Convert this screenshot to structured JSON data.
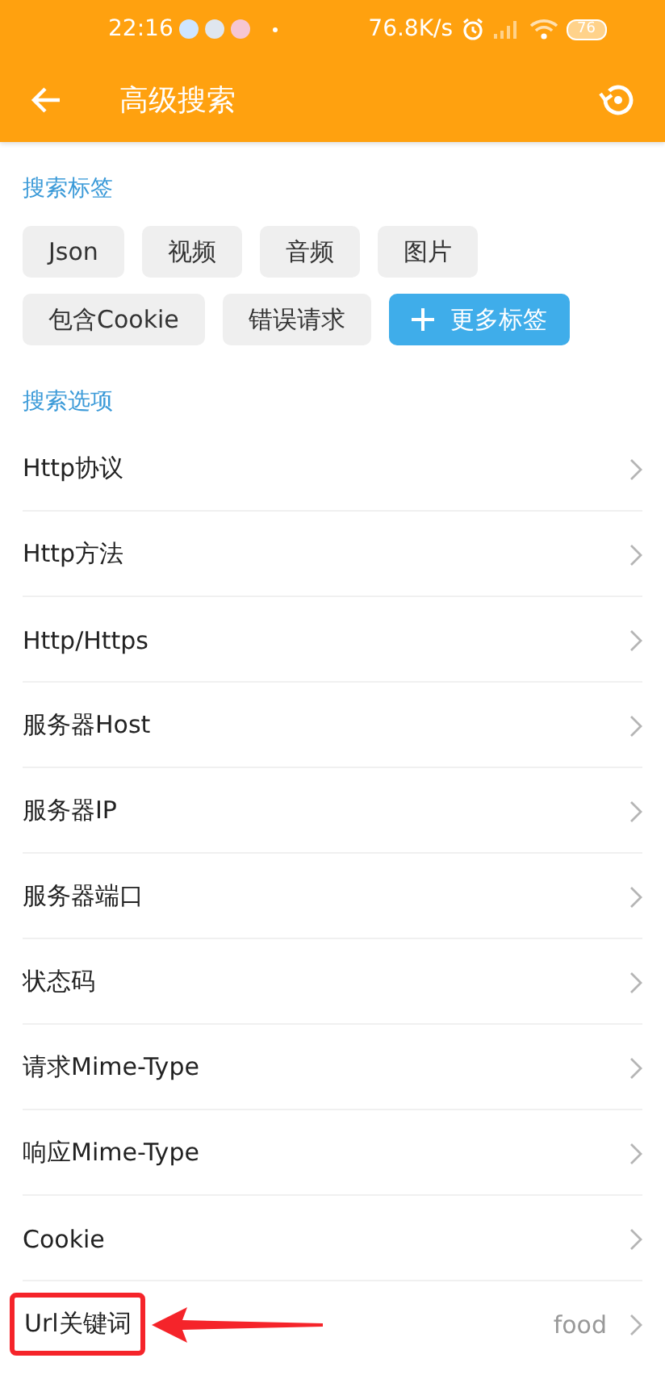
{
  "status_bar": {
    "time": "22:16",
    "speed": "76.8K/s",
    "battery": "76"
  },
  "header": {
    "title": "高级搜索"
  },
  "tags_section": {
    "title": "搜索标签",
    "tags": [
      {
        "label": "Json",
        "kind": "tag"
      },
      {
        "label": "视频",
        "kind": "tag"
      },
      {
        "label": "音频",
        "kind": "tag"
      },
      {
        "label": "图片",
        "kind": "tag"
      },
      {
        "label": "包含Cookie",
        "kind": "tag"
      },
      {
        "label": "错误请求",
        "kind": "tag"
      },
      {
        "label": "更多标签",
        "kind": "add"
      }
    ]
  },
  "options_section": {
    "title": "搜索选项",
    "items": [
      {
        "label": "Http协议",
        "highlighted": false
      },
      {
        "label": "Http方法",
        "highlighted": false
      },
      {
        "label": "Http/Https",
        "highlighted": false
      },
      {
        "label": "服务器Host",
        "highlighted": false
      },
      {
        "label": "服务器IP",
        "highlighted": false
      },
      {
        "label": "服务器端口",
        "highlighted": false
      },
      {
        "label": "状态码",
        "highlighted": false
      },
      {
        "label": "请求Mime-Type",
        "highlighted": false
      },
      {
        "label": "响应Mime-Type",
        "highlighted": false
      },
      {
        "label": "Cookie",
        "highlighted": false
      },
      {
        "label": "Url关键词",
        "value": "food",
        "highlighted": true
      }
    ]
  }
}
